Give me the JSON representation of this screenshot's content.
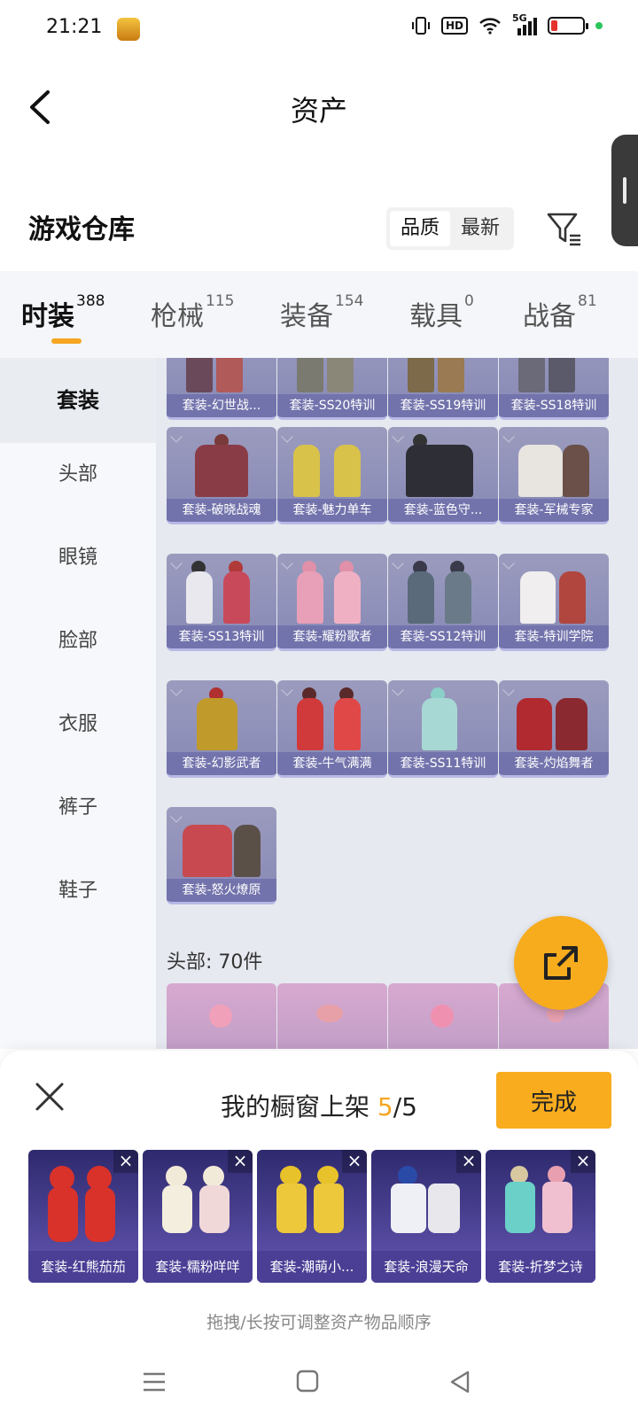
{
  "status": {
    "time": "21:21",
    "network": "5G",
    "hd": "HD"
  },
  "header": {
    "title": "资产"
  },
  "warehouse": {
    "title": "游戏仓库",
    "sort": [
      "品质",
      "最新"
    ]
  },
  "tabs": [
    {
      "label": "时装",
      "count": "388"
    },
    {
      "label": "枪械",
      "count": "115"
    },
    {
      "label": "装备",
      "count": "154"
    },
    {
      "label": "载具",
      "count": "0"
    },
    {
      "label": "战备",
      "count": "81"
    }
  ],
  "categories": [
    "套装",
    "头部",
    "眼镜",
    "脸部",
    "衣服",
    "裤子",
    "鞋子"
  ],
  "items": [
    {
      "label": "套装-幻世战..."
    },
    {
      "label": "套装-SS20特训"
    },
    {
      "label": "套装-SS19特训"
    },
    {
      "label": "套装-SS18特训"
    },
    {
      "label": "套装-破晓战魂"
    },
    {
      "label": "套装-魅力单车"
    },
    {
      "label": "套装-蓝色守..."
    },
    {
      "label": "套装-军械专家"
    },
    {
      "label": "套装-SS13特训"
    },
    {
      "label": "套装-耀粉歌者"
    },
    {
      "label": "套装-SS12特训"
    },
    {
      "label": "套装-特训学院"
    },
    {
      "label": "套装-幻影武者"
    },
    {
      "label": "套装-牛气满满"
    },
    {
      "label": "套装-SS11特训"
    },
    {
      "label": "套装-灼焰舞者"
    },
    {
      "label": "套装-怒火燎原"
    }
  ],
  "section": {
    "label": "头部: 70件"
  },
  "sheet": {
    "title": "我的橱窗上架",
    "count_now": "5",
    "count_sep": "/5",
    "done_label": "完成",
    "hint": "拖拽/长按可调整资产物品顺序",
    "shelf": [
      {
        "label": "套装-红熊茄茄"
      },
      {
        "label": "套装-糯粉咩咩"
      },
      {
        "label": "套装-潮萌小..."
      },
      {
        "label": "套装-浪漫天命"
      },
      {
        "label": "套装-折梦之诗"
      }
    ]
  },
  "colors": {
    "accent": "#f5a623",
    "button": "#f8ac1e",
    "card": "#9b9bbe",
    "shelf": "#4a3f95"
  }
}
